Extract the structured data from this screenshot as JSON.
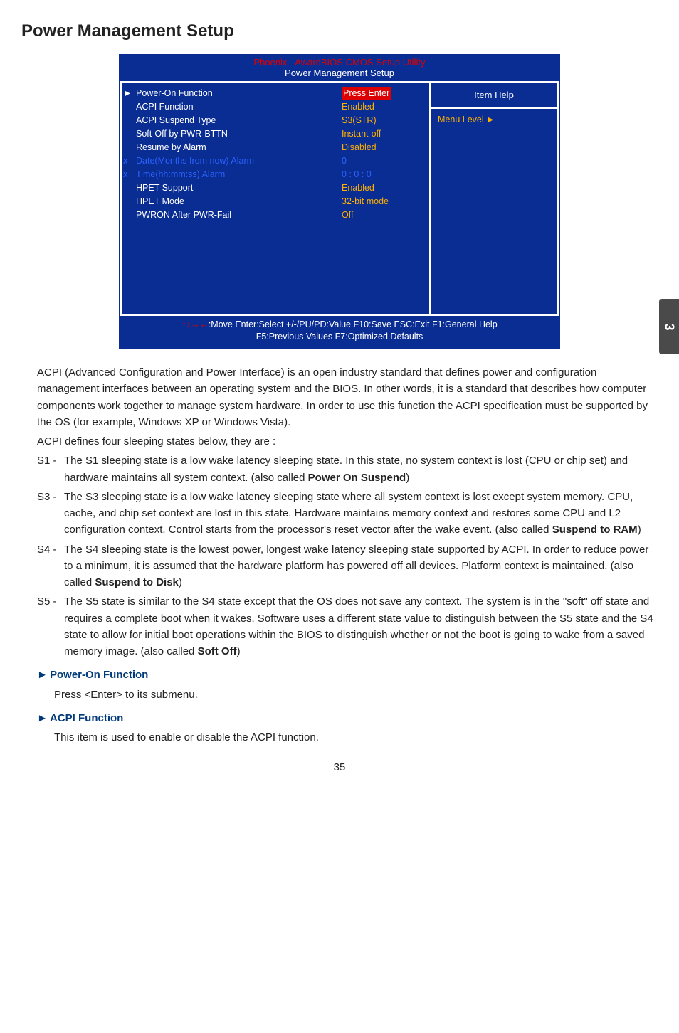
{
  "section_title": "Power Management Setup",
  "bios": {
    "title": "Phoenix - AwardBIOS CMOS Setup Utility",
    "subtitle": "Power Management Setup",
    "rows": [
      {
        "marker": "►",
        "marker_class": "",
        "label": "Power-On Function",
        "label_class": "",
        "value": "Press Enter",
        "value_class": "press-enter"
      },
      {
        "marker": "",
        "marker_class": "",
        "label": "ACPI Function",
        "label_class": "",
        "value": "Enabled",
        "value_class": ""
      },
      {
        "marker": "",
        "marker_class": "",
        "label": "ACPI Suspend Type",
        "label_class": "",
        "value": "S3(STR)",
        "value_class": ""
      },
      {
        "marker": "",
        "marker_class": "",
        "label": "Soft-Off by PWR-BTTN",
        "label_class": "",
        "value": "Instant-off",
        "value_class": ""
      },
      {
        "marker": "",
        "marker_class": "",
        "label": "Resume by Alarm",
        "label_class": "",
        "value": "Disabled",
        "value_class": ""
      },
      {
        "marker": "x",
        "marker_class": "x",
        "label": "Date(Months from now) Alarm",
        "label_class": "blue",
        "value": "0",
        "value_class": "blue"
      },
      {
        "marker": "x",
        "marker_class": "x",
        "label": "Time(hh:mm:ss) Alarm",
        "label_class": "blue",
        "value": "0  :  0  :  0",
        "value_class": "blue"
      },
      {
        "marker": "",
        "marker_class": "",
        "label": "HPET Support",
        "label_class": "",
        "value": "Enabled",
        "value_class": ""
      },
      {
        "marker": "",
        "marker_class": "",
        "label": "HPET Mode",
        "label_class": "",
        "value": "32-bit mode",
        "value_class": ""
      },
      {
        "marker": "",
        "marker_class": "",
        "label": "PWRON After PWR-Fail",
        "label_class": "",
        "value": "Off",
        "value_class": ""
      }
    ],
    "help_title": "Item Help",
    "menu_level": "Menu Level  ►",
    "footer_arrows": "↑↓→←",
    "footer_line1": ":Move   Enter:Select   +/-/PU/PD:Value   F10:Save     ESC:Exit  F1:General Help",
    "footer_line2": "F5:Previous Values                       F7:Optimized Defaults"
  },
  "page_tab": "3",
  "intro": {
    "p1": "ACPI (Advanced Configuration and Power Interface) is an open industry standard that defines power and configuration management interfaces between an operating system and the BIOS. In other words, it is a standard that describes how computer components work together to manage system hardware. In order to use this function the ACPI specification must be supported by the OS (for example, Windows XP or Windows Vista).",
    "p2": "ACPI defines four sleeping states below, they are :"
  },
  "states": {
    "s1": {
      "tag": "S1 - ",
      "body_a": "The S1 sleeping state is a low wake latency sleeping state. In this state, no system context is lost (CPU or chip set) and hardware maintains all system context. (also called ",
      "bold": "Power On Suspend",
      "body_b": ")"
    },
    "s3": {
      "tag": "S3 - ",
      "body_a": "The S3 sleeping state is a low wake latency sleeping state where all system context is lost except system memory. CPU, cache, and chip set context are lost in this state. Hardware maintains memory context and restores some CPU and L2 configuration context. Control starts from the processor's reset vector after the wake event. (also called ",
      "bold": "Suspend to RAM",
      "body_b": ")"
    },
    "s4": {
      "tag": "S4 - ",
      "body_a": "The S4 sleeping state is the lowest power, longest wake latency sleeping state supported by ACPI. In order to reduce power to a minimum, it is assumed that the hardware platform has powered off all devices. Platform context is maintained. (also called ",
      "bold": "Suspend to Disk",
      "body_b": ")"
    },
    "s5": {
      "tag": "S5 - ",
      "body_a": "The S5 state is similar to the S4 state except that the OS does not save any context. The system is in the \"soft\" off state and requires a complete boot when it wakes. Software uses a different state value to distinguish between the S5 state and the S4 state to allow for initial boot operations within the BIOS to distinguish whether or not the boot is going to wake from a saved memory image.  (also called ",
      "bold": "Soft Off",
      "body_b": ")"
    }
  },
  "subs": {
    "pof_title": "Power-On Function",
    "pof_body": "Press <Enter> to its submenu.",
    "acpi_title": "ACPI Function",
    "acpi_body": "This item is used to enable or disable the ACPI function."
  },
  "page_num": "35"
}
